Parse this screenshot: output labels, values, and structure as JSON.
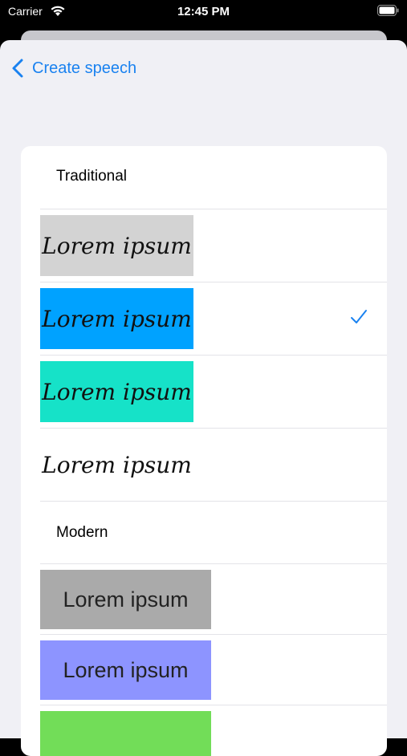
{
  "status": {
    "carrier": "Carrier",
    "time": "12:45 PM"
  },
  "nav": {
    "back_label": "Create speech"
  },
  "sections": {
    "traditional": {
      "header": "Traditional",
      "items": [
        {
          "text": "Lorem ipsum",
          "color": "#d3d3d3",
          "selected": false
        },
        {
          "text": "Lorem ipsum",
          "color": "#00a2ff",
          "selected": true
        },
        {
          "text": "Lorem ipsum",
          "color": "#16e2c8",
          "selected": false
        },
        {
          "text": "Lorem ipsum",
          "color": "#ffffff",
          "selected": false
        }
      ]
    },
    "modern": {
      "header": "Modern",
      "items": [
        {
          "text": "Lorem ipsum",
          "color": "#aaaaaa",
          "selected": false
        },
        {
          "text": "Lorem ipsum",
          "color": "#8d94ff",
          "selected": false
        },
        {
          "text": "",
          "color": "#72dd58",
          "selected": false
        }
      ]
    }
  },
  "colors": {
    "accent": "#1a82f0",
    "background": "#f0f0f5"
  }
}
